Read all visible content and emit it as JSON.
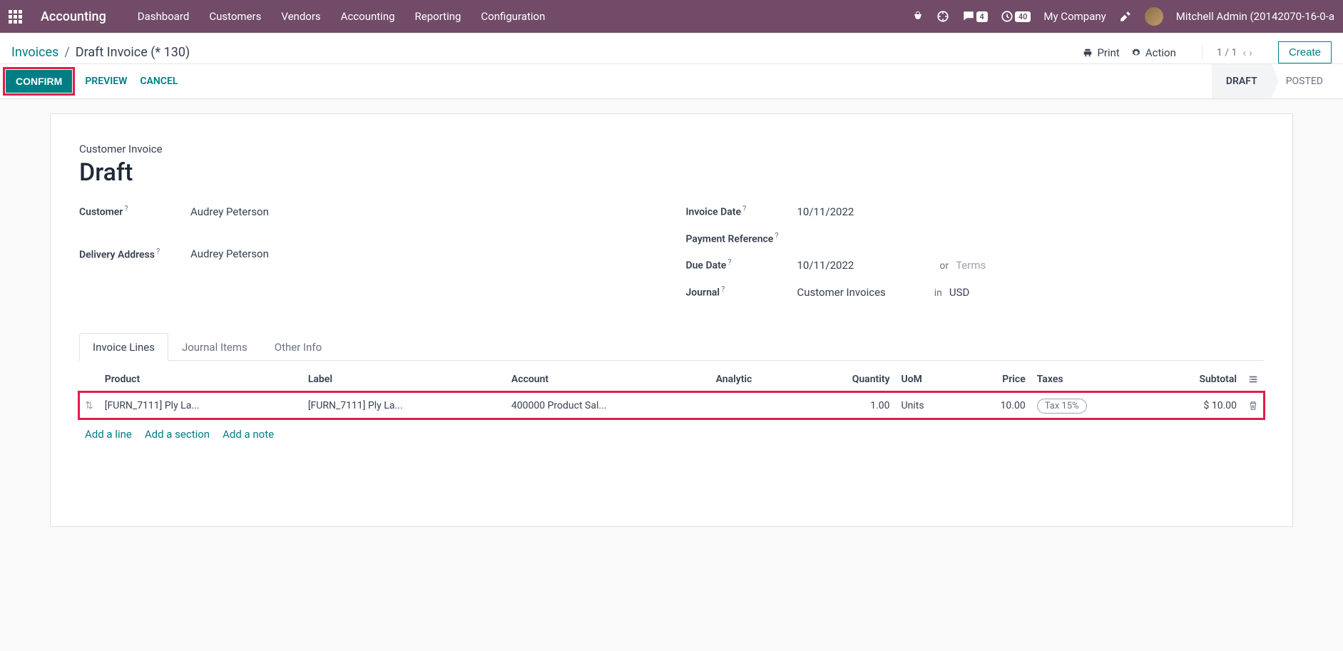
{
  "navbar": {
    "app_name": "Accounting",
    "menu": [
      "Dashboard",
      "Customers",
      "Vendors",
      "Accounting",
      "Reporting",
      "Configuration"
    ],
    "msg_badge": "4",
    "activity_badge": "40",
    "company": "My Company",
    "user": "Mitchell Admin (20142070-16-0-a"
  },
  "breadcrumb": {
    "root": "Invoices",
    "current": "Draft Invoice (* 130)"
  },
  "controls": {
    "print": "Print",
    "action": "Action",
    "pager": "1 / 1",
    "create": "Create"
  },
  "actions": {
    "confirm": "CONFIRM",
    "preview": "PREVIEW",
    "cancel": "CANCEL"
  },
  "status": {
    "draft": "DRAFT",
    "posted": "POSTED"
  },
  "form": {
    "doc_type": "Customer Invoice",
    "title": "Draft",
    "customer_label": "Customer",
    "customer_value": "Audrey Peterson",
    "delivery_label": "Delivery Address",
    "delivery_value": "Audrey Peterson",
    "invoice_date_label": "Invoice Date",
    "invoice_date_value": "10/11/2022",
    "payment_ref_label": "Payment Reference",
    "due_date_label": "Due Date",
    "due_date_value": "10/11/2022",
    "or_text": "or",
    "terms_placeholder": "Terms",
    "journal_label": "Journal",
    "journal_value": "Customer Invoices",
    "in_text": "in",
    "currency": "USD"
  },
  "tabs": {
    "lines": "Invoice Lines",
    "journal": "Journal Items",
    "other": "Other Info"
  },
  "table": {
    "headers": {
      "product": "Product",
      "label": "Label",
      "account": "Account",
      "analytic": "Analytic",
      "quantity": "Quantity",
      "uom": "UoM",
      "price": "Price",
      "taxes": "Taxes",
      "subtotal": "Subtotal"
    },
    "row": {
      "product": "[FURN_7111] Ply La...",
      "label": "[FURN_7111] Ply La...",
      "account": "400000 Product Sal...",
      "analytic": "",
      "quantity": "1.00",
      "uom": "Units",
      "price": "10.00",
      "tax": "Tax 15%",
      "subtotal": "$ 10.00"
    },
    "add_line": "Add a line",
    "add_section": "Add a section",
    "add_note": "Add a note"
  }
}
